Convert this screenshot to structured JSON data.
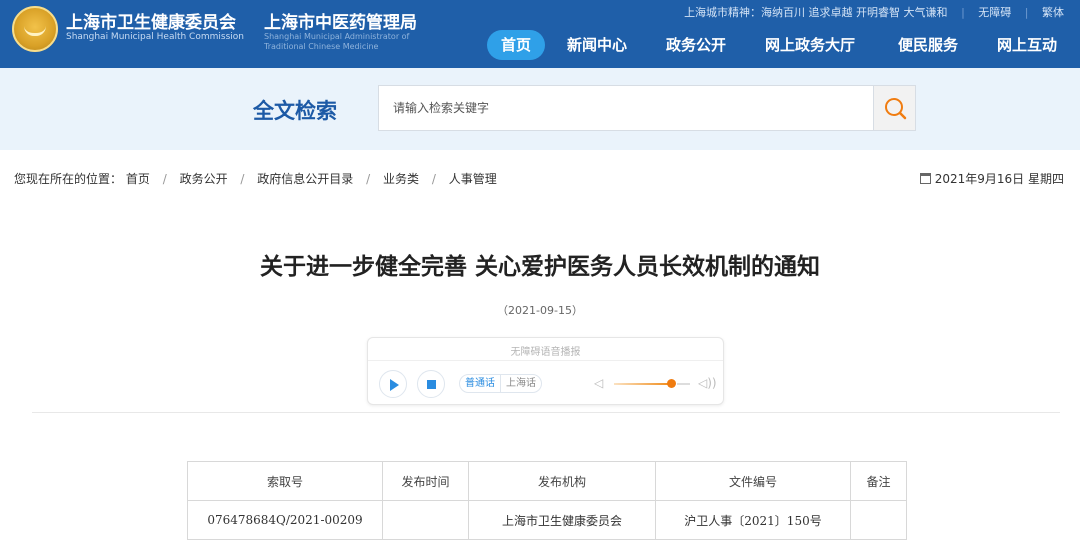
{
  "header": {
    "org1_cn": "上海市卫生健康委员会",
    "org1_en": "Shanghai Municipal Health Commission",
    "org2_cn": "上海市中医药管理局",
    "org2_en": "Shanghai Municipal Administrator of Traditional Chinese Medicine",
    "spirit": "上海城市精神：海纳百川 追求卓越 开明睿智 大气谦和",
    "accessibility": "无障碍",
    "traditional": "繁体",
    "nav": [
      "首页",
      "新闻中心",
      "政务公开",
      "网上政务大厅",
      "便民服务",
      "网上互动"
    ],
    "colors": {
      "header_bg": "#1f5fa9",
      "nav_active": "#2fa0e8"
    }
  },
  "search": {
    "title": "全文检索",
    "placeholder": "请输入检索关键字",
    "button_icon": "search-icon"
  },
  "breadcrumb": {
    "prefix": "您现在所在的位置：",
    "items": [
      "首页",
      "政务公开",
      "政府信息公开目录",
      "业务类",
      "人事管理"
    ]
  },
  "date_display": "2021年9月16日 星期四",
  "article": {
    "title": "关于进一步健全完善 关心爱护医务人员长效机制的通知",
    "date": "（2021-09-15）"
  },
  "player": {
    "title": "无障碍语音播报",
    "lang_mandarin": "普通话",
    "lang_shanghai": "上海话",
    "volume": 0.75
  },
  "meta_table": {
    "headers": [
      "索取号",
      "发布时间",
      "发布机构",
      "文件编号",
      "备注"
    ],
    "rows": [
      [
        "076478684Q/2021-00209",
        "",
        "上海市卫生健康委员会",
        "沪卫人事〔2021〕150号",
        ""
      ]
    ]
  }
}
